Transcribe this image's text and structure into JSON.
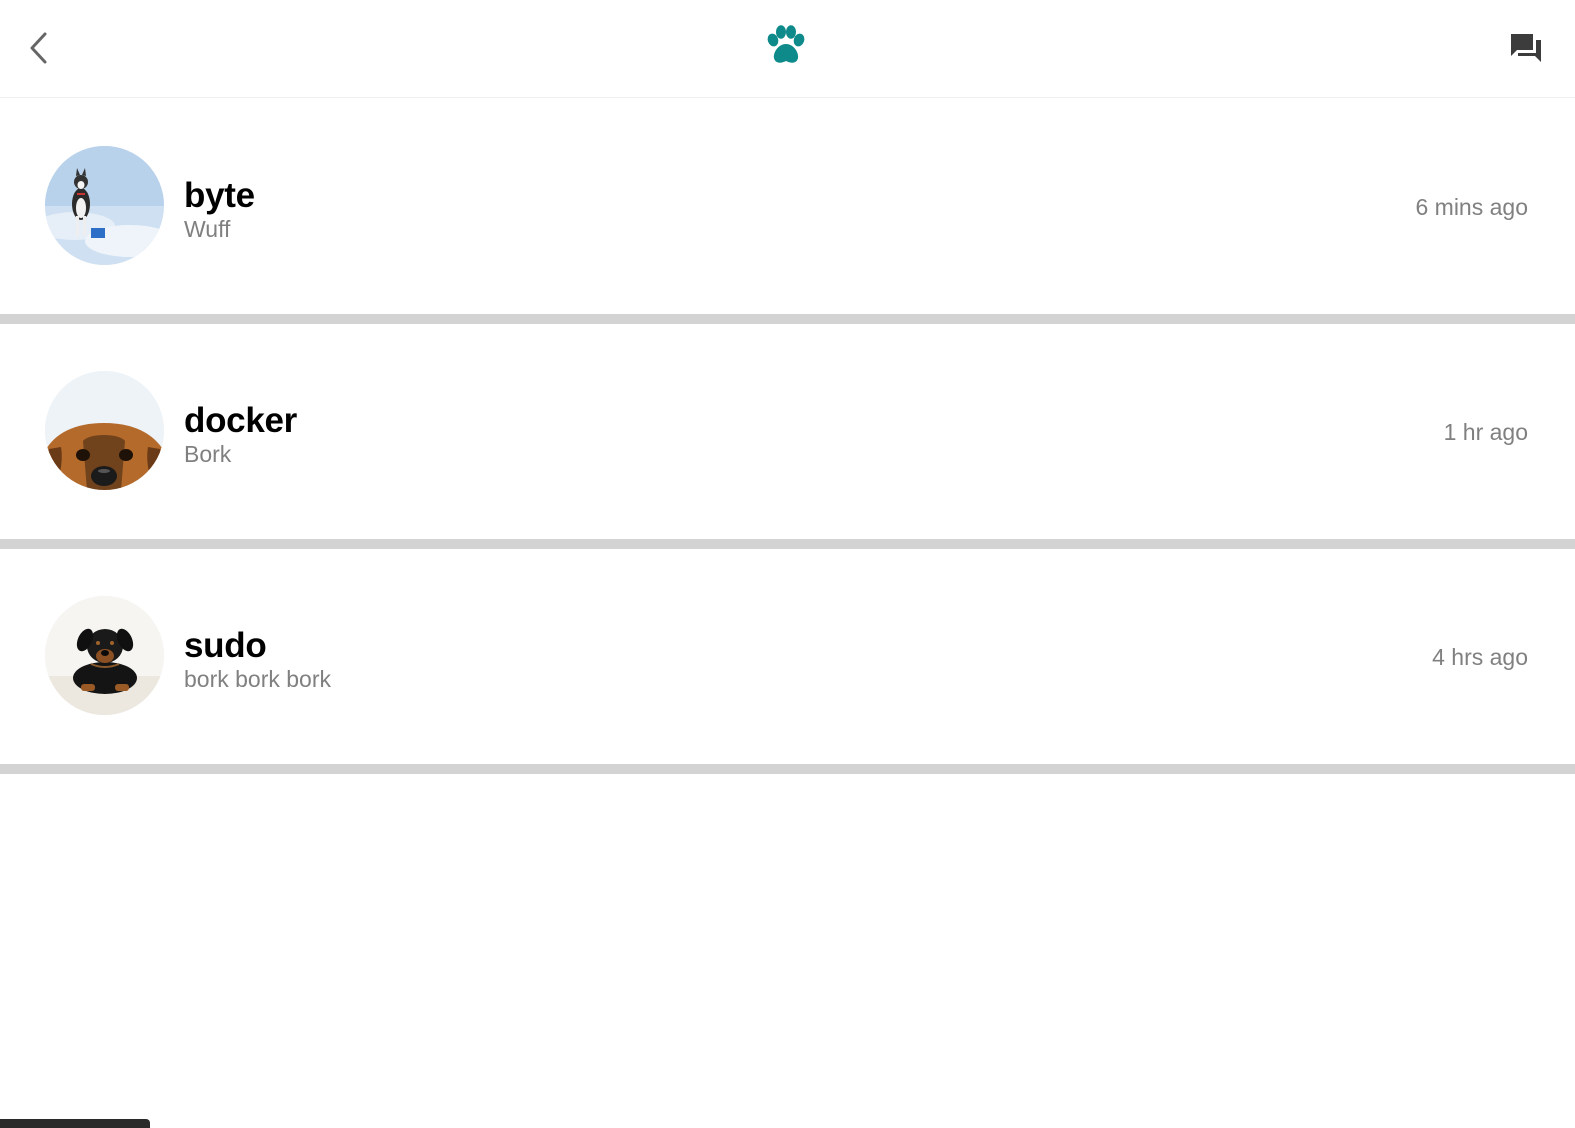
{
  "header": {
    "back_icon": "chevron-left-icon",
    "logo_icon": "paw-icon",
    "chat_icon": "forum-icon",
    "accent_color": "#0f8a8a"
  },
  "conversations": [
    {
      "name": "byte",
      "message": "Wuff",
      "time": "6 mins ago",
      "avatar": "husky-on-snow"
    },
    {
      "name": "docker",
      "message": "Bork",
      "time": "1 hr ago",
      "avatar": "peeking-brown-dog"
    },
    {
      "name": "sudo",
      "message": "bork bork bork",
      "time": "4 hrs ago",
      "avatar": "black-tan-puppy"
    }
  ]
}
